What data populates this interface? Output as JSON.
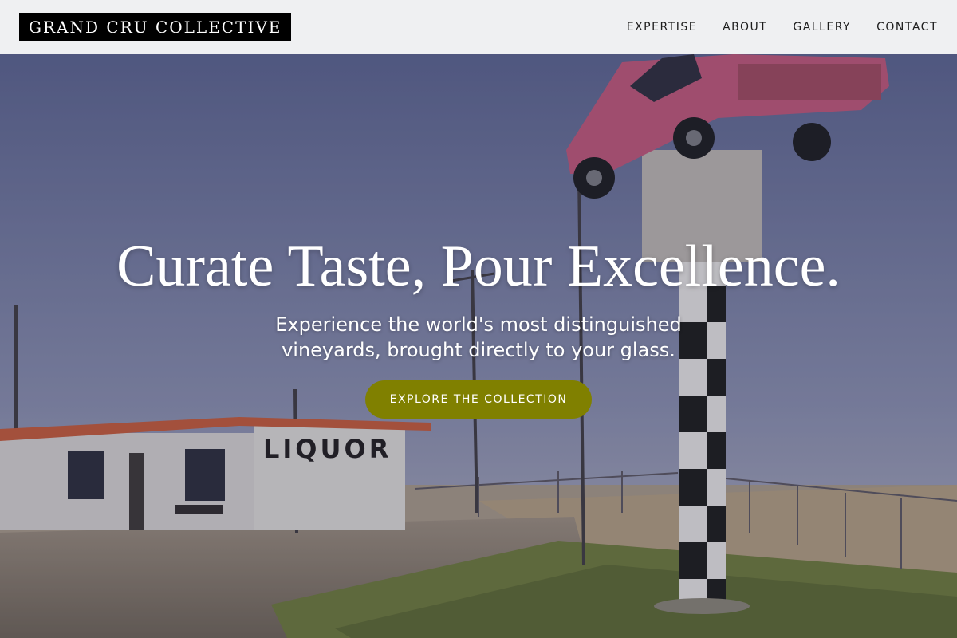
{
  "brand": {
    "name": "GRAND CRU COLLECTIVE"
  },
  "nav": {
    "items": [
      {
        "label": "EXPERTISE"
      },
      {
        "label": "ABOUT"
      },
      {
        "label": "GALLERY"
      },
      {
        "label": "CONTACT"
      }
    ]
  },
  "hero": {
    "title": "Curate Taste, Pour Excellence.",
    "subtitle": "Experience the world's most distinguished vineyards, brought directly to your glass.",
    "cta_label": "EXPLORE THE COLLECTION",
    "scene_sign_text": "LIQUOR",
    "colors": {
      "cta": "#808000",
      "header_bg": "#eff0f2",
      "logo_bg": "#000000"
    }
  }
}
